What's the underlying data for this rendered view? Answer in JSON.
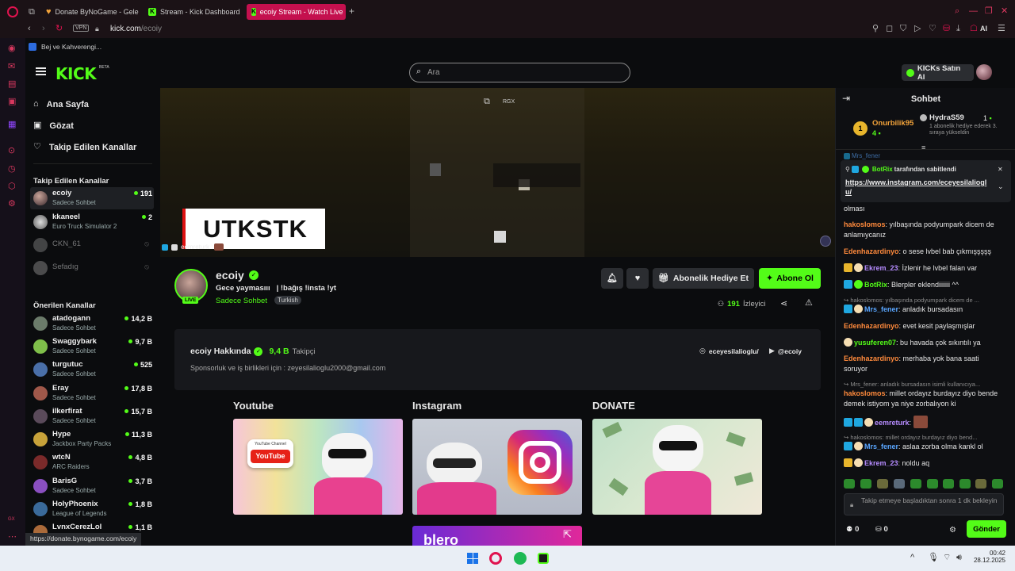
{
  "browser": {
    "tabs": [
      {
        "label": "Donate ByNoGame - Gele",
        "icon": "heart-icon"
      },
      {
        "label": "Stream - Kick Dashboard",
        "icon": "kick-icon"
      },
      {
        "label": "ecoiy Stream - Watch Live",
        "icon": "kick-icon",
        "active": true
      }
    ],
    "new_tab": "+",
    "vpn": "VPN",
    "url_domain": "kick.com",
    "url_path": "/ecoiy",
    "bookmark": "Bej ve Kahverengi...",
    "ai_label": "AI",
    "status_url": "https://donate.bynogame.com/ecoiy"
  },
  "header": {
    "logo": "KICK",
    "logo_beta": "BETA",
    "search_placeholder": "Ara",
    "buy_kicks": "KICKs Satın Al"
  },
  "sidebar": {
    "nav": [
      {
        "label": "Ana Sayfa",
        "icon": "home-icon"
      },
      {
        "label": "Gözat",
        "icon": "browse-icon"
      },
      {
        "label": "Takip Edilen Kanallar",
        "icon": "heart-icon"
      }
    ],
    "followed_title": "Takip Edilen Kanallar",
    "followed": [
      {
        "name": "ecoiy",
        "sub": "Sadece Sohbet",
        "count": "191",
        "live": true
      },
      {
        "name": "kkaneel",
        "sub": "Euro Truck Simulator 2",
        "count": "2",
        "live": true
      },
      {
        "name": "CKN_61",
        "sub": "",
        "count": "",
        "live": false
      },
      {
        "name": "Sefadıg",
        "sub": "",
        "count": "",
        "live": false
      }
    ],
    "recommended_title": "Önerilen Kanallar",
    "recommended": [
      {
        "name": "atadogann",
        "sub": "Sadece Sohbet",
        "count": "14,2 B"
      },
      {
        "name": "Swaggybark",
        "sub": "Sadece Sohbet",
        "count": "9,7 B"
      },
      {
        "name": "turgutuc",
        "sub": "Sadece Sohbet",
        "count": "525"
      },
      {
        "name": "Eray",
        "sub": "Sadece Sohbet",
        "count": "17,8 B"
      },
      {
        "name": "ilkerfirat",
        "sub": "Sadece Sohbet",
        "count": "15,7 B"
      },
      {
        "name": "Hype",
        "sub": "Jackbox Party Packs",
        "count": "11,3 B"
      },
      {
        "name": "wtcN",
        "sub": "ARC Raiders",
        "count": "4,8 B"
      },
      {
        "name": "BarisG",
        "sub": "Sadece Sohbet",
        "count": "3,7 B"
      },
      {
        "name": "HolyPhoenix",
        "sub": "League of Legends",
        "count": "1,8 B"
      },
      {
        "name": "LvnxCerezLol",
        "sub": "",
        "count": "1,1 B"
      }
    ]
  },
  "video": {
    "overlay_label": "RGX",
    "banner_text": "UTKSTK",
    "chat_overlay_user": "eemreturk :"
  },
  "channel": {
    "name": "ecoiy",
    "live_badge": "LIVE",
    "title_a": "Gece yaymasııı",
    "title_b": "| !bağış !insta !yt",
    "category": "Sadece Sohbet",
    "language": "Turkish",
    "gift_sub": "Abonelik Hediye Et",
    "subscribe": "Abone Ol",
    "viewers": "191",
    "viewers_label": "İzleyici"
  },
  "about": {
    "title": "ecoiy Hakkında",
    "followers": "9,4 B",
    "followers_label": "Takipçi",
    "description": "Sponsorluk ve iş birlikleri için : zeyesilalioglu2000@gmail.com",
    "instagram": "eceyesilalioglu/",
    "youtube": "@ecoiy"
  },
  "panels": [
    {
      "title": "Youtube",
      "logo_top": "YouTube Channel",
      "logo_text": "YouTube"
    },
    {
      "title": "Instagram"
    },
    {
      "title": "DONATE"
    }
  ],
  "extra_panel_text": "blero",
  "chat": {
    "title": "Sohbet",
    "leader1_rank": "1",
    "leader1_name": "Onurbilik95",
    "leader1_count": "4",
    "leader2_name": "HydraS59",
    "leader2_count": "1",
    "leader2_note": "1 abonelik hediye ederek 3. sıraya yükseldi̇n",
    "partial_top_user": "Mrs_fener",
    "pinned_by_user": "BotRix",
    "pinned_by_text": "tarafından sabitlendi",
    "pinned_link": "https://www.instagram.com/eceyesilalioglu/",
    "messages": [
      {
        "user": "",
        "text": "olması",
        "color": "#e6e6e6"
      },
      {
        "user": "hakoslomos",
        "text": ": yılbaşında podyumpark dicem de anlamıycanız",
        "color": "#ff8a3c"
      },
      {
        "user": "Edenhazardinyo",
        "text": ": o sese lvbel bab çıkmışşşşş",
        "color": "#ff8a3c"
      },
      {
        "user": "Ekrem_23",
        "text": ": İzlenir he lvbel falan var",
        "color": "#b68cff"
      },
      {
        "user": "BotRix",
        "text": ": Blerpler eklendiiiiiii ^^",
        "color": "#53fc18"
      },
      {
        "reply": "hakoslomos: yılbaşında podyumpark dicem de ..."
      },
      {
        "user": "Mrs_fener",
        "text": ": anladık bursadasın",
        "color": "#5aa6ff"
      },
      {
        "user": "Edenhazardinyo",
        "text": ": evet kesit paylaşmışlar",
        "color": "#ff8a3c"
      },
      {
        "user": "yusuferen07",
        "text": ": bu havada çok sıkıntılı ya",
        "color": "#53fc18"
      },
      {
        "user": "Edenhazardinyo",
        "text": ": merhaba yok bana saati soruyor",
        "color": "#ff8a3c"
      },
      {
        "reply": "Mrs_fener: anladık bursadasın isimli kullanıcıya..."
      },
      {
        "user": "hakoslomos",
        "text": ": millet ordayız burdayız diyo bende demek istiyom ya niye zorbalıyon ki",
        "color": "#ff8a3c"
      },
      {
        "user": "eemreturk",
        "text": ":",
        "color": "#b68cff"
      },
      {
        "reply": "hakoslomos: millet ordayız burdayız diyo bend..."
      },
      {
        "user": "Mrs_fener",
        "text": ": aslaa zorba olma kankl ol",
        "color": "#5aa6ff"
      },
      {
        "user": "Ekrem_23",
        "text": ": noldu aq",
        "color": "#b68cff"
      }
    ],
    "input_placeholder": "Takip etmeye başladıktan sonra 1 dk bekleyin",
    "points_a": "0",
    "points_b": "0",
    "send": "Gönder"
  },
  "taskbar": {
    "time": "00:42",
    "date": "28.12.2025"
  }
}
